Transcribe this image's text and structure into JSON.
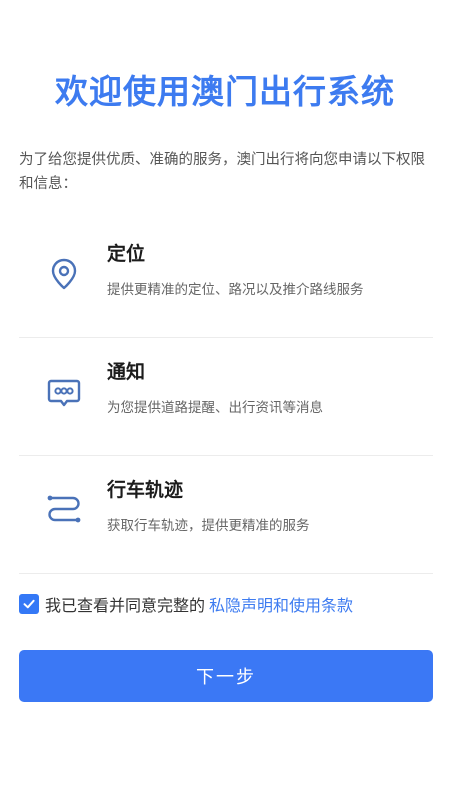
{
  "title": "欢迎使用澳门出行系统",
  "intro": "为了给您提供优质、准确的服务，澳门出行将向您申请以下权限和信息：",
  "permissions": [
    {
      "icon": "location-pin-icon",
      "title": "定位",
      "description": "提供更精准的定位、路况以及推介路线服务"
    },
    {
      "icon": "message-bubble-icon",
      "title": "通知",
      "description": "为您提供道路提醒、出行资讯等消息"
    },
    {
      "icon": "route-track-icon",
      "title": "行车轨迹",
      "description": "获取行车轨迹，提供更精准的服务"
    }
  ],
  "agreement": {
    "checked": true,
    "text": "我已查看并同意完整的",
    "link": "私隐声明和使用条款"
  },
  "next_button": "下一步",
  "colors": {
    "accent": "#3d7bf0",
    "icon": "#4a72b8",
    "button": "#3b78f5"
  }
}
